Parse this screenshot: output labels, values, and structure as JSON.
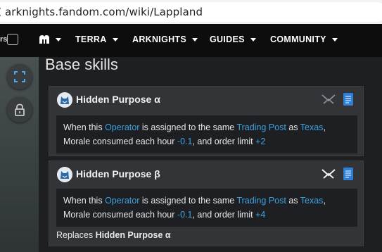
{
  "browser": {
    "url": "arknights.fandom.com/wiki/Lappland"
  },
  "nav": {
    "logo_fragment": "rs",
    "items": [
      {
        "label": ""
      },
      {
        "label": "TERRA"
      },
      {
        "label": "ARKNIGHTS"
      },
      {
        "label": "GUIDES"
      },
      {
        "label": "COMMUNITY"
      }
    ]
  },
  "rail": {
    "buttons": [
      "expand-icon",
      "lock-icon"
    ]
  },
  "section": {
    "title": "Base skills"
  },
  "skills": [
    {
      "name": "Hidden Purpose α",
      "desc": {
        "p1": "When this ",
        "link1": "Operator",
        "p2": " is assigned to the same ",
        "link2": "Trading Post",
        "p3": " as ",
        "link3": "Texas",
        "p4": ", Morale consumed each hour ",
        "val1": "-0.1",
        "p5": ", and order limit ",
        "val2": "+2"
      }
    },
    {
      "name": "Hidden Purpose β",
      "desc": {
        "p1": "When this ",
        "link1": "Operator",
        "p2": " is assigned to the same ",
        "link2": "Trading Post",
        "p3": " as ",
        "link3": "Texas",
        "p4": ", Morale consumed each hour ",
        "val1": "-0.1",
        "p5": ", and order limit ",
        "val2": "+4"
      },
      "replaces_label": "Replaces ",
      "replaces_name": "Hidden Purpose α"
    }
  ],
  "colors": {
    "link": "#3fa2e0",
    "card_bg": "#323438",
    "desc_bg": "#1d1f22",
    "doc_icon": "#2f7fd6"
  }
}
